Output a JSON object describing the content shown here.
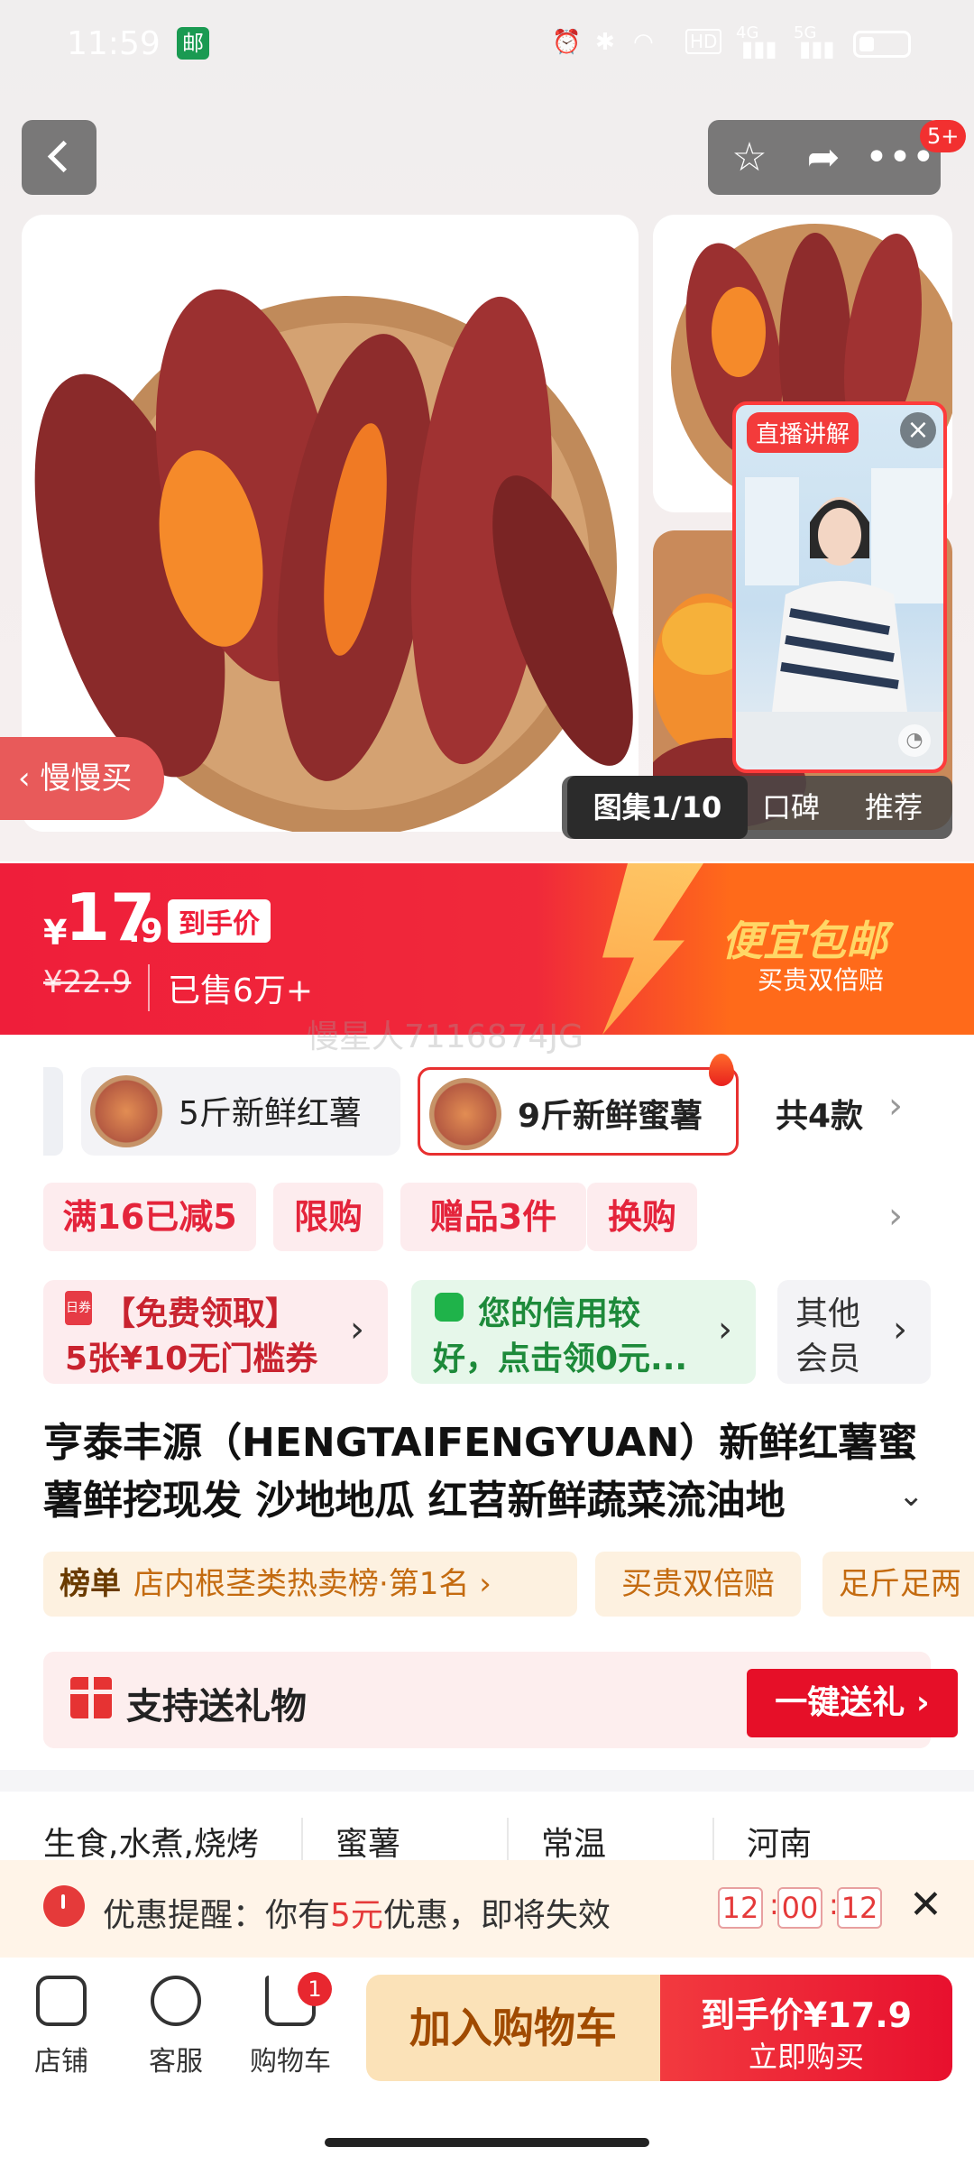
{
  "status_bar": {
    "time": "11:59",
    "network_1": "4G",
    "network_2": "5G",
    "hd": "HD"
  },
  "header": {
    "badge": "5+"
  },
  "gallery": {
    "live_tag": "直播讲解",
    "slow_buy": "慢慢买",
    "tabs": [
      "图集1/10",
      "口碑",
      "推荐"
    ]
  },
  "price": {
    "currency": "¥",
    "integer": "17",
    "decimal": ".9",
    "tag": "到手价",
    "original": "¥22.9",
    "sold": "已售6万+",
    "slogan": "便宜包邮",
    "sub": "买贵双倍赔"
  },
  "watermark": "慢星人7116874JG",
  "variants": {
    "items": [
      "5斤新鲜红薯",
      "9斤新鲜蜜薯"
    ],
    "total": "共4款"
  },
  "promos": [
    "满16已减5",
    "限购",
    "赠品3件",
    "换购"
  ],
  "coupons": {
    "c1_line1": "【免费领取】",
    "c1_line2": "5张¥10无门槛券",
    "c2_line1": "您的信用较",
    "c2_line2": "好，点击领0元...",
    "c3_line1": "其他",
    "c3_line2": "会员"
  },
  "product": {
    "title": "亨泰丰源（HENGTAIFENGYUAN）新鲜红薯蜜薯鲜挖现发 沙地地瓜 红苕新鲜蔬菜流油地"
  },
  "ranking": {
    "label": "榜单",
    "text": "店内根茎类热卖榜·第1名",
    "chip2": "买贵双倍赔",
    "chip3": "足斤足两"
  },
  "gift": {
    "text": "支持送礼物",
    "button": "一键送礼"
  },
  "attributes": [
    "生食,水煮,烧烤",
    "蜜薯",
    "常温",
    "河南"
  ],
  "reminder": {
    "prefix": "优惠提醒：你有",
    "amount": "5元",
    "suffix": "优惠，即将失效",
    "hh": "12",
    "mm": "00",
    "ss": "12"
  },
  "bottom_nav": {
    "shop": "店铺",
    "service": "客服",
    "cart": "购物车",
    "cart_badge": "1",
    "add_cart": "加入购物车",
    "buy_price": "到手价¥17.9",
    "buy_label": "立即购买"
  }
}
